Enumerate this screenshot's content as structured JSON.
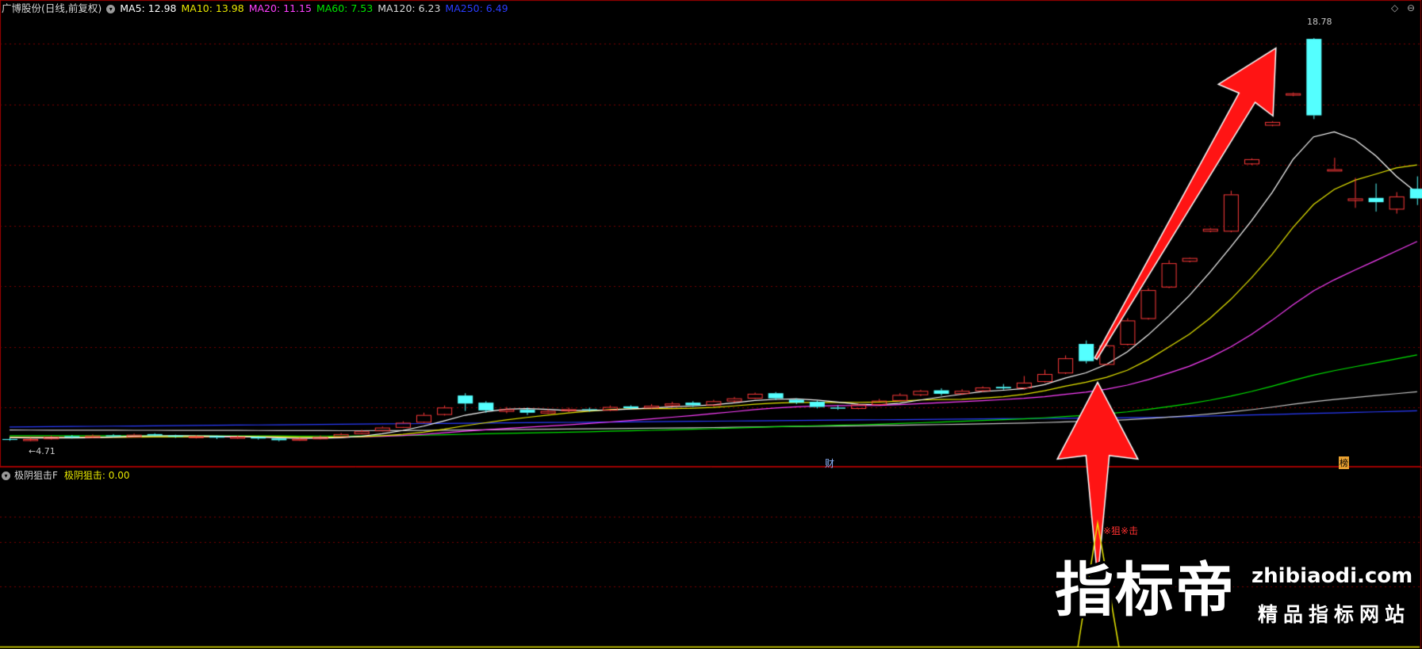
{
  "header": {
    "stock_title": "广博股份(日线,前复权)",
    "ma5": "MA5: 12.98",
    "ma10": "MA10: 13.98",
    "ma20": "MA20: 11.15",
    "ma60": "MA60: 7.53",
    "ma120": "MA120: 6.23",
    "ma250": "MA250: 6.49"
  },
  "colors": {
    "ma5": "#ffffff",
    "ma10": "#e8e800",
    "ma20": "#ff40ff",
    "ma60": "#00e600",
    "ma120": "#c8c8c8",
    "ma250": "#2a3cff",
    "up": "#ff3a3a",
    "down": "#54ffff",
    "grid": "#7a0000"
  },
  "annotations": {
    "high": "18.78",
    "low": "4.71",
    "marker_cai": "财",
    "marker_bang": "榜",
    "signal_text": "※狙※击"
  },
  "indicator": {
    "name": "极阴狙击F",
    "value_label": "极阴狙击: 0.00"
  },
  "watermark": {
    "cn": "指标帝",
    "en": "zhibiaodi.com",
    "sub": "精品指标网站"
  },
  "icons": [
    "collapse-circle-icon",
    "diamond-icon",
    "up-arrow-icon"
  ],
  "chart_data": {
    "type": "candlestick",
    "y_range_upper": [
      4.2,
      19.5
    ],
    "candles": [
      [
        4.78,
        4.75,
        4.82,
        4.72
      ],
      [
        4.74,
        4.78,
        4.82,
        4.71
      ],
      [
        4.8,
        4.86,
        4.9,
        4.76
      ],
      [
        4.88,
        4.84,
        4.92,
        4.8
      ],
      [
        4.85,
        4.9,
        4.94,
        4.82
      ],
      [
        4.91,
        4.88,
        4.95,
        4.84
      ],
      [
        4.87,
        4.93,
        4.97,
        4.85
      ],
      [
        4.95,
        4.91,
        4.98,
        4.88
      ],
      [
        4.9,
        4.86,
        4.93,
        4.82
      ],
      [
        4.84,
        4.88,
        4.92,
        4.8
      ],
      [
        4.87,
        4.83,
        4.9,
        4.78
      ],
      [
        4.82,
        4.86,
        4.9,
        4.79
      ],
      [
        4.85,
        4.8,
        4.88,
        4.76
      ],
      [
        4.8,
        4.74,
        4.82,
        4.7
      ],
      [
        4.75,
        4.79,
        4.83,
        4.72
      ],
      [
        4.8,
        4.86,
        4.9,
        4.77
      ],
      [
        4.88,
        4.95,
        4.99,
        4.85
      ],
      [
        4.98,
        5.05,
        5.1,
        4.95
      ],
      [
        5.08,
        5.18,
        5.22,
        5.05
      ],
      [
        5.2,
        5.35,
        5.4,
        5.18
      ],
      [
        5.38,
        5.62,
        5.7,
        5.35
      ],
      [
        5.65,
        5.88,
        5.95,
        5.6
      ],
      [
        6.3,
        6.02,
        6.38,
        5.76
      ],
      [
        6.05,
        5.78,
        6.1,
        5.7
      ],
      [
        5.76,
        5.82,
        5.9,
        5.68
      ],
      [
        5.8,
        5.7,
        5.88,
        5.62
      ],
      [
        5.7,
        5.76,
        5.82,
        5.66
      ],
      [
        5.78,
        5.82,
        5.88,
        5.72
      ],
      [
        5.82,
        5.8,
        5.88,
        5.74
      ],
      [
        5.8,
        5.9,
        5.95,
        5.76
      ],
      [
        5.92,
        5.86,
        5.96,
        5.82
      ],
      [
        5.88,
        5.94,
        6.0,
        5.84
      ],
      [
        5.96,
        6.02,
        6.08,
        5.92
      ],
      [
        6.05,
        5.96,
        6.1,
        5.9
      ],
      [
        5.98,
        6.1,
        6.15,
        5.92
      ],
      [
        6.12,
        6.2,
        6.25,
        6.05
      ],
      [
        6.22,
        6.36,
        6.4,
        6.18
      ],
      [
        6.38,
        6.2,
        6.42,
        6.14
      ],
      [
        6.15,
        6.05,
        6.2,
        6.0
      ],
      [
        6.08,
        5.9,
        6.12,
        5.85
      ],
      [
        5.88,
        5.84,
        5.95,
        5.8
      ],
      [
        5.86,
        5.98,
        6.02,
        5.82
      ],
      [
        6.0,
        6.12,
        6.18,
        5.96
      ],
      [
        6.14,
        6.32,
        6.38,
        6.1
      ],
      [
        6.34,
        6.46,
        6.5,
        6.28
      ],
      [
        6.48,
        6.36,
        6.55,
        6.3
      ],
      [
        6.38,
        6.46,
        6.52,
        6.32
      ],
      [
        6.48,
        6.58,
        6.62,
        6.42
      ],
      [
        6.6,
        6.55,
        6.7,
        6.5
      ],
      [
        6.58,
        6.75,
        6.98,
        6.5
      ],
      [
        6.8,
        7.05,
        7.2,
        6.75
      ],
      [
        7.1,
        7.6,
        7.7,
        7.05
      ],
      [
        8.1,
        7.5,
        8.22,
        7.42
      ],
      [
        7.4,
        8.05,
        8.4,
        7.35
      ],
      [
        8.1,
        8.92,
        9.0,
        8.05
      ],
      [
        9.0,
        9.98,
        10.05,
        8.95
      ],
      [
        10.1,
        10.92,
        11.02,
        10.05
      ],
      [
        11.0,
        11.1,
        11.12,
        10.95
      ],
      [
        12.05,
        12.12,
        12.15,
        12.0
      ],
      [
        12.05,
        13.32,
        13.45,
        12.0
      ],
      [
        14.4,
        14.55,
        14.58,
        14.35
      ],
      [
        15.75,
        15.85,
        15.88,
        15.7
      ],
      [
        16.8,
        16.85,
        16.88,
        16.75
      ],
      [
        18.75,
        16.08,
        18.78,
        15.95
      ],
      [
        14.15,
        14.2,
        14.6,
        14.15
      ],
      [
        13.12,
        13.18,
        13.9,
        12.85
      ],
      [
        13.2,
        13.05,
        13.7,
        12.72
      ],
      [
        12.82,
        13.25,
        13.4,
        12.65
      ],
      [
        13.52,
        13.18,
        13.95,
        12.95
      ]
    ]
  }
}
